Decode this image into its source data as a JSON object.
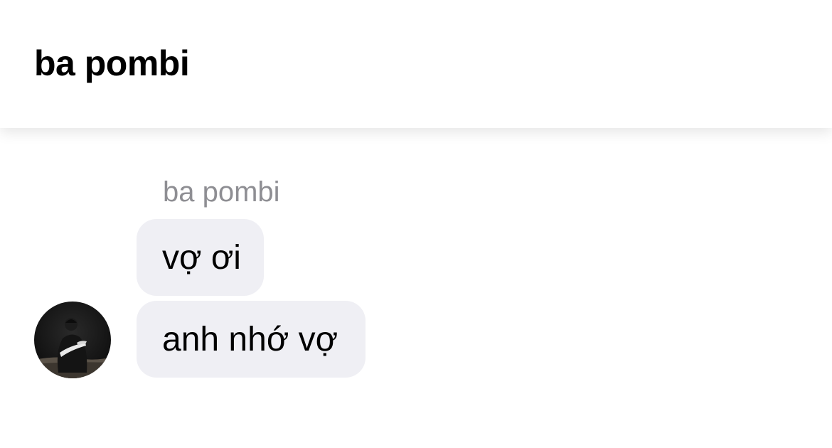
{
  "header": {
    "title": "ba pombi"
  },
  "thread": {
    "sender_name": "ba pombi",
    "messages": [
      {
        "text": "vợ ơi"
      },
      {
        "text": "anh nhớ vợ"
      }
    ],
    "avatar": {
      "icon": "profile-photo"
    }
  },
  "colors": {
    "bubble_background": "#efeff4",
    "sender_name": "#8e8e93",
    "text": "#000000",
    "background": "#ffffff"
  }
}
